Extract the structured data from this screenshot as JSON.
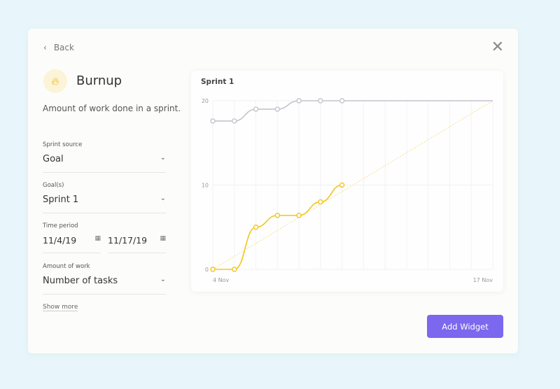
{
  "header": {
    "back_label": "Back",
    "close_icon": "close-icon"
  },
  "widget": {
    "title": "Burnup",
    "icon": "flame-icon",
    "description": "Amount of work done in a sprint."
  },
  "form": {
    "sprint_source": {
      "label": "Sprint source",
      "value": "Goal"
    },
    "goals": {
      "label": "Goal(s)",
      "value": "Sprint 1"
    },
    "time_period": {
      "label": "Time period",
      "start": "11/4/19",
      "end": "11/17/19"
    },
    "amount_of_work": {
      "label": "Amount of work",
      "value": "Number of tasks"
    },
    "show_more": "Show more"
  },
  "add_widget_label": "Add Widget",
  "colors": {
    "accent": "#7b68ee",
    "completed": "#f5c518",
    "scope": "#c4c4cc",
    "ideal": "#f7e3a0"
  },
  "chart_data": {
    "type": "line",
    "title": "Sprint 1",
    "x_tick_labels": [
      "4 Nov",
      "17 Nov"
    ],
    "x": [
      "4 Nov",
      "5 Nov",
      "6 Nov",
      "7 Nov",
      "8 Nov",
      "9 Nov",
      "10 Nov"
    ],
    "x_range_days": 13,
    "y_ticks": [
      0,
      10,
      20
    ],
    "ylim": [
      0,
      20
    ],
    "grid": true,
    "series": [
      {
        "key": "scope",
        "values": [
          17.6,
          17.6,
          19,
          19,
          20,
          20,
          20
        ],
        "extends_to_end": true
      },
      {
        "key": "completed",
        "values": [
          0,
          0,
          5,
          6.4,
          6.4,
          8,
          10
        ]
      },
      {
        "key": "ideal",
        "start": 0,
        "end": 20,
        "style": "dotted"
      }
    ]
  }
}
